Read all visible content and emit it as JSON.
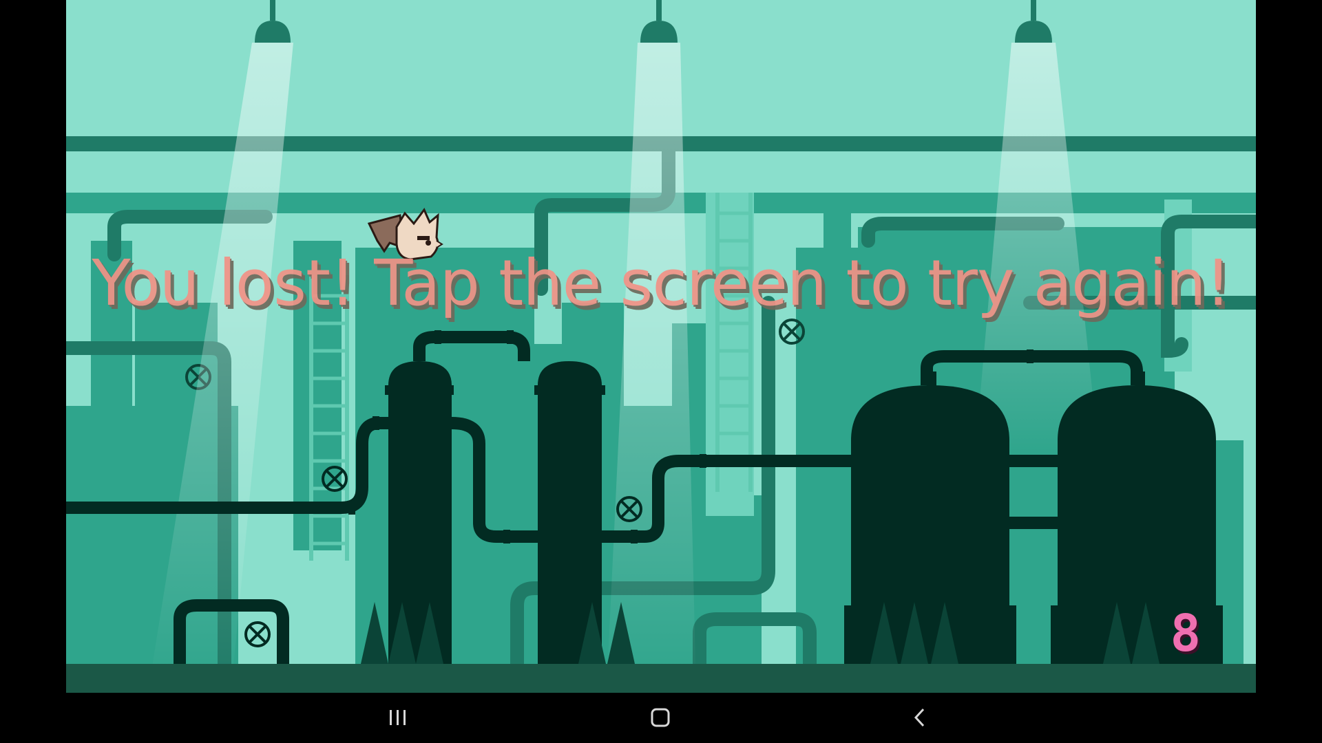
{
  "game": {
    "message": "You lost! Tap the screen to try again!",
    "score": "8",
    "colors": {
      "sky": "#8adfcc",
      "far_structures": "#2fa58c",
      "pipes": "#1f7b67",
      "silhouettes": "#022b22",
      "ground": "#1b5847",
      "message": "#f29286",
      "score": "#ef6fb0"
    }
  },
  "player": {
    "icon": "bat-creature-icon"
  },
  "navbar": {
    "recent_icon": "recent-apps-icon",
    "home_icon": "home-icon",
    "back_icon": "back-icon"
  }
}
